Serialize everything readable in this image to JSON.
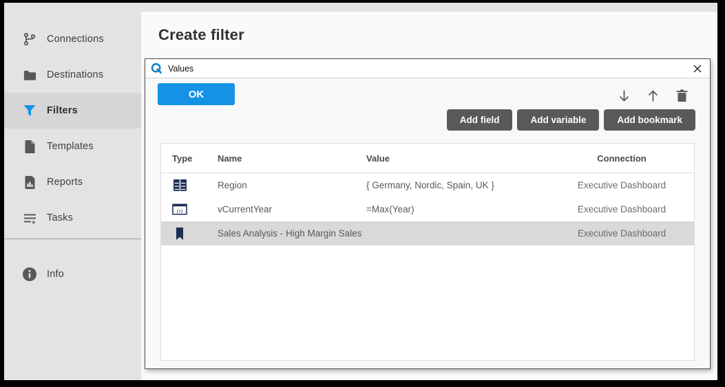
{
  "page": {
    "heading": "Create filter"
  },
  "sidebar": {
    "items": [
      {
        "label": "Connections",
        "icon": "branch-icon",
        "active": false
      },
      {
        "label": "Destinations",
        "icon": "folder-icon",
        "active": false
      },
      {
        "label": "Filters",
        "icon": "funnel-icon",
        "active": true
      },
      {
        "label": "Templates",
        "icon": "document-icon",
        "active": false
      },
      {
        "label": "Reports",
        "icon": "report-chart-icon",
        "active": false
      },
      {
        "label": "Tasks",
        "icon": "task-list-icon",
        "active": false
      }
    ],
    "info": {
      "label": "Info",
      "icon": "info-icon"
    }
  },
  "dialog": {
    "title": "Values",
    "logo_icon": "qlik-logo-icon",
    "close_icon": "close-icon",
    "ok_label": "OK",
    "move_icons": [
      "move-down-icon",
      "move-up-icon",
      "delete-icon"
    ],
    "add_buttons": [
      {
        "label": "Add field"
      },
      {
        "label": "Add variable"
      },
      {
        "label": "Add bookmark"
      }
    ],
    "table": {
      "headers": {
        "type": "Type",
        "name": "Name",
        "value": "Value",
        "connection": "Connection"
      },
      "rows": [
        {
          "type_icon": "field-table-icon",
          "name": "Region",
          "value": "{ Germany, Nordic, Spain, UK }",
          "connection": "Executive Dashboard",
          "selected": false
        },
        {
          "type_icon": "variable-icon",
          "variable_glyph": "(x)",
          "name": "vCurrentYear",
          "value": "=Max(Year)",
          "connection": "Executive Dashboard",
          "selected": false
        },
        {
          "type_icon": "bookmark-icon",
          "name": "Sales Analysis - High Margin Sales",
          "value": "",
          "connection": "Executive Dashboard",
          "selected": true
        }
      ]
    }
  },
  "colors": {
    "accent_blue": "#1592e6",
    "button_gray": "#595959",
    "row_icon_navy": "#1c2e54",
    "selected_row": "#d9d9d9",
    "sidebar_gray": "#e3e3e3"
  }
}
